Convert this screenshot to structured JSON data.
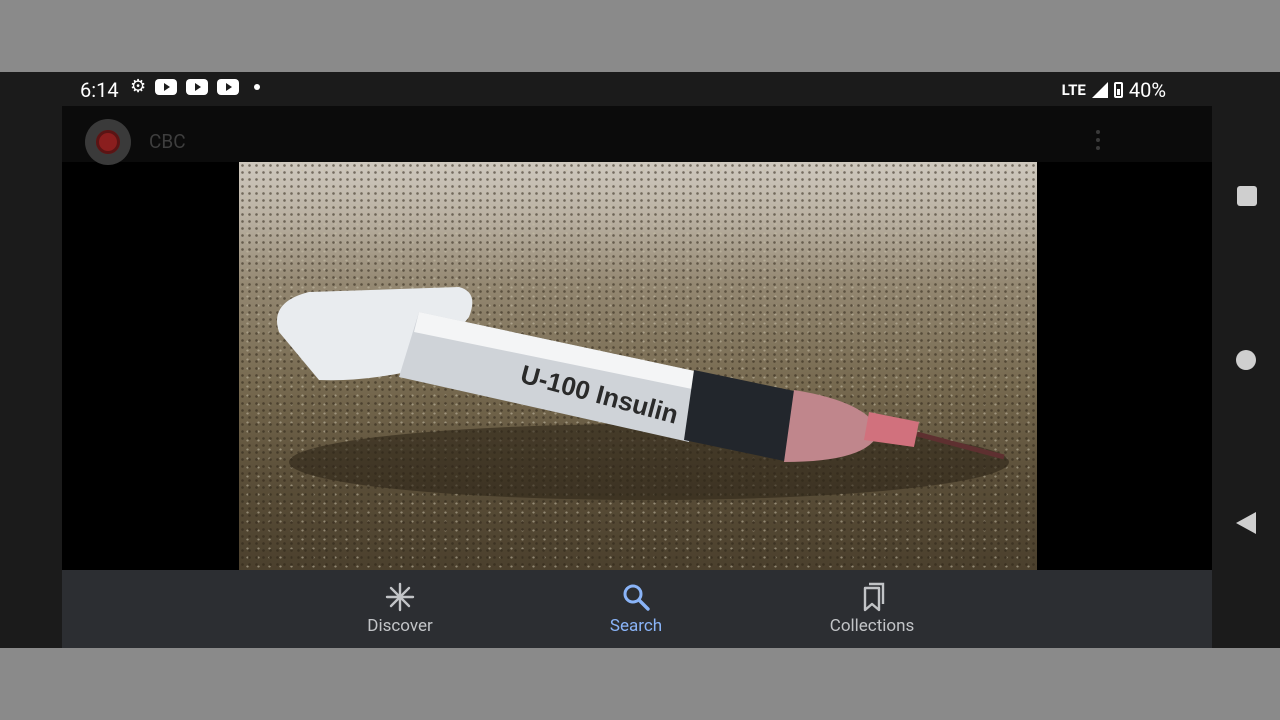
{
  "status_bar": {
    "time": "6:14",
    "network": "LTE",
    "battery": "40%",
    "icons_left": [
      "gear-icon",
      "youtube-icon",
      "youtube-icon",
      "youtube-icon",
      "dot-icon"
    ]
  },
  "header": {
    "source": "CBC"
  },
  "photo": {
    "syringe_text": "U-100 Insulin"
  },
  "bottom_nav": {
    "items": [
      {
        "label": "Discover",
        "icon": "asterisk-icon",
        "active": false
      },
      {
        "label": "Search",
        "icon": "search-icon",
        "active": true
      },
      {
        "label": "Collections",
        "icon": "collections-icon",
        "active": false
      }
    ]
  },
  "colors": {
    "active_accent": "#8ab4f8",
    "nav_background": "#2c2e32"
  }
}
